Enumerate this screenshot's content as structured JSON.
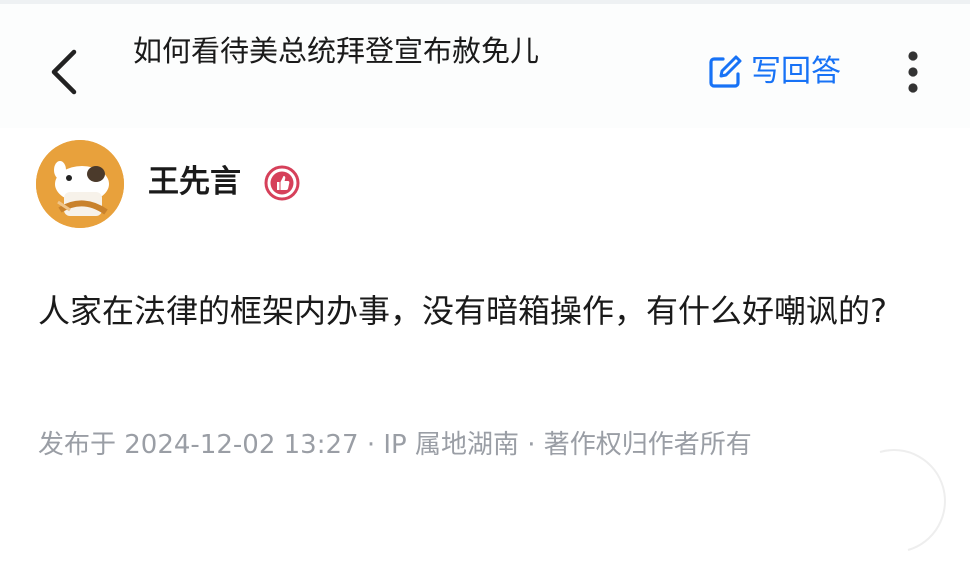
{
  "header": {
    "question_title": "如何看待美总统拜登宣布赦免儿",
    "back_icon": "chevron-left-icon",
    "write_answer_icon": "edit-icon",
    "write_answer_label": "写回答",
    "more_icon": "vertical-dots-icon"
  },
  "author": {
    "name": "王先言",
    "badge_icon": "thumbs-up-badge-icon"
  },
  "answer": {
    "content": "人家在法律的框架内办事，没有暗箱操作，有什么好嘲讽的?"
  },
  "meta": {
    "text": "发布于 2024-12-02 13:27 · IP 属地湖南 · 著作权归作者所有"
  },
  "colors": {
    "accent": "#1772f6",
    "badge_red": "#d6405a",
    "meta_gray": "#9a9ea5"
  }
}
